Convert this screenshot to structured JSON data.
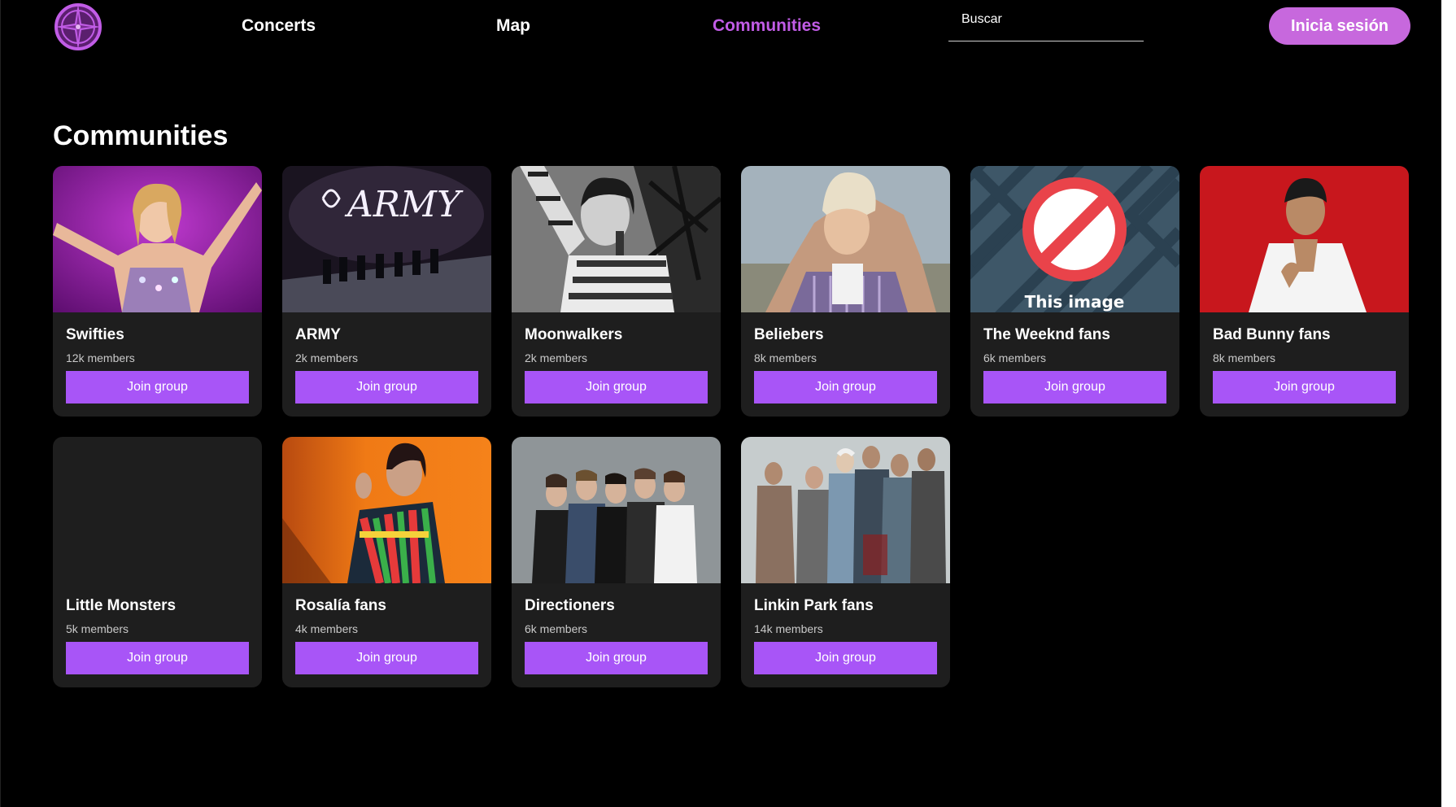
{
  "nav": {
    "links": [
      {
        "label": "Concerts"
      },
      {
        "label": "Map"
      },
      {
        "label": "Communities"
      }
    ],
    "search_placeholder": "Buscar",
    "login_label": "Inicia sesión",
    "accent_color": "#c15ce6"
  },
  "page": {
    "title": "Communities"
  },
  "communities": [
    {
      "name": "Swifties",
      "members": "12k members",
      "join_label": "Join group",
      "image": "taylor-swift-photo"
    },
    {
      "name": "ARMY",
      "members": "2k members",
      "join_label": "Join group",
      "image": "bts-army-photo"
    },
    {
      "name": "Moonwalkers",
      "members": "2k members",
      "join_label": "Join group",
      "image": "michael-jackson-photo"
    },
    {
      "name": "Beliebers",
      "members": "8k members",
      "join_label": "Join group",
      "image": "justin-bieber-photo"
    },
    {
      "name": "The Weeknd fans",
      "members": "6k members",
      "join_label": "Join group",
      "image": "image-unavailable-placeholder",
      "image_text": "This image"
    },
    {
      "name": "Bad Bunny fans",
      "members": "8k members",
      "join_label": "Join group",
      "image": "bad-bunny-photo"
    },
    {
      "name": "Little Monsters",
      "members": "5k members",
      "join_label": "Join group",
      "image": "none"
    },
    {
      "name": "Rosalía fans",
      "members": "4k members",
      "join_label": "Join group",
      "image": "rosalia-photo"
    },
    {
      "name": "Directioners",
      "members": "6k members",
      "join_label": "Join group",
      "image": "one-direction-photo"
    },
    {
      "name": "Linkin Park fans",
      "members": "14k members",
      "join_label": "Join group",
      "image": "linkin-park-photo"
    }
  ],
  "colors": {
    "button": "#a855f7",
    "card": "#1e1e1e",
    "login": "#c768dd"
  }
}
